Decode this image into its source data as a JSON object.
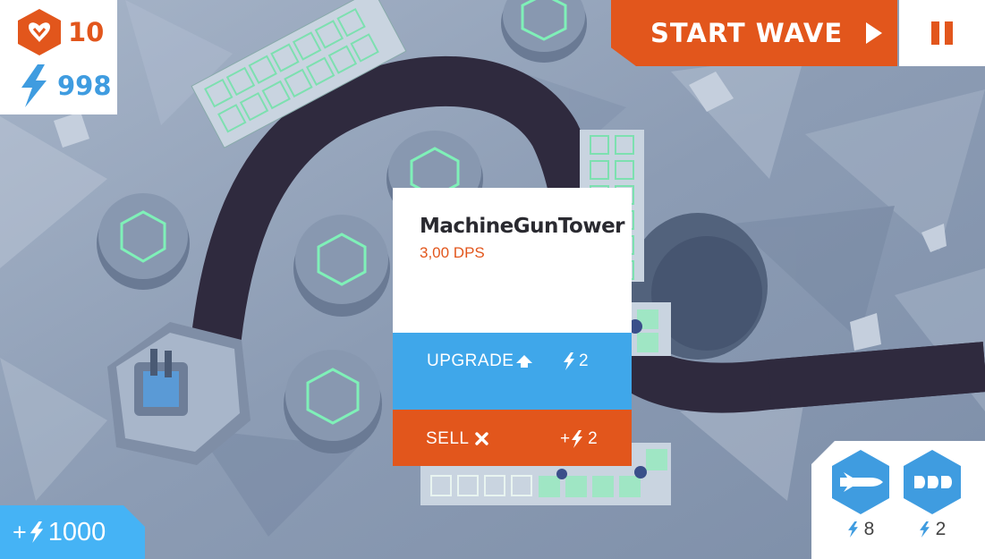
{
  "hud": {
    "lives": "10",
    "energy": "998",
    "lives_icon": "heart-shield-icon",
    "energy_icon": "lightning-icon"
  },
  "controls": {
    "start_wave_label": "START WAVE",
    "start_wave_icon": "play-icon",
    "pause_icon": "pause-icon"
  },
  "tower_popup": {
    "name": "MachineGunTower",
    "dps": "3,00 DPS",
    "upgrade_label": "UPGRADE",
    "upgrade_cost": "2",
    "sell_label": "SELL",
    "sell_prefix": "+",
    "sell_value": "2"
  },
  "bonus": {
    "plus": "+",
    "amount": "1000"
  },
  "abilities": [
    {
      "icon": "missile-icon",
      "cost": "8"
    },
    {
      "icon": "triple-bullet-icon",
      "cost": "2"
    }
  ],
  "colors": {
    "orange": "#e2561c",
    "blue": "#3fa7ea",
    "hud_white": "#ffffff"
  }
}
